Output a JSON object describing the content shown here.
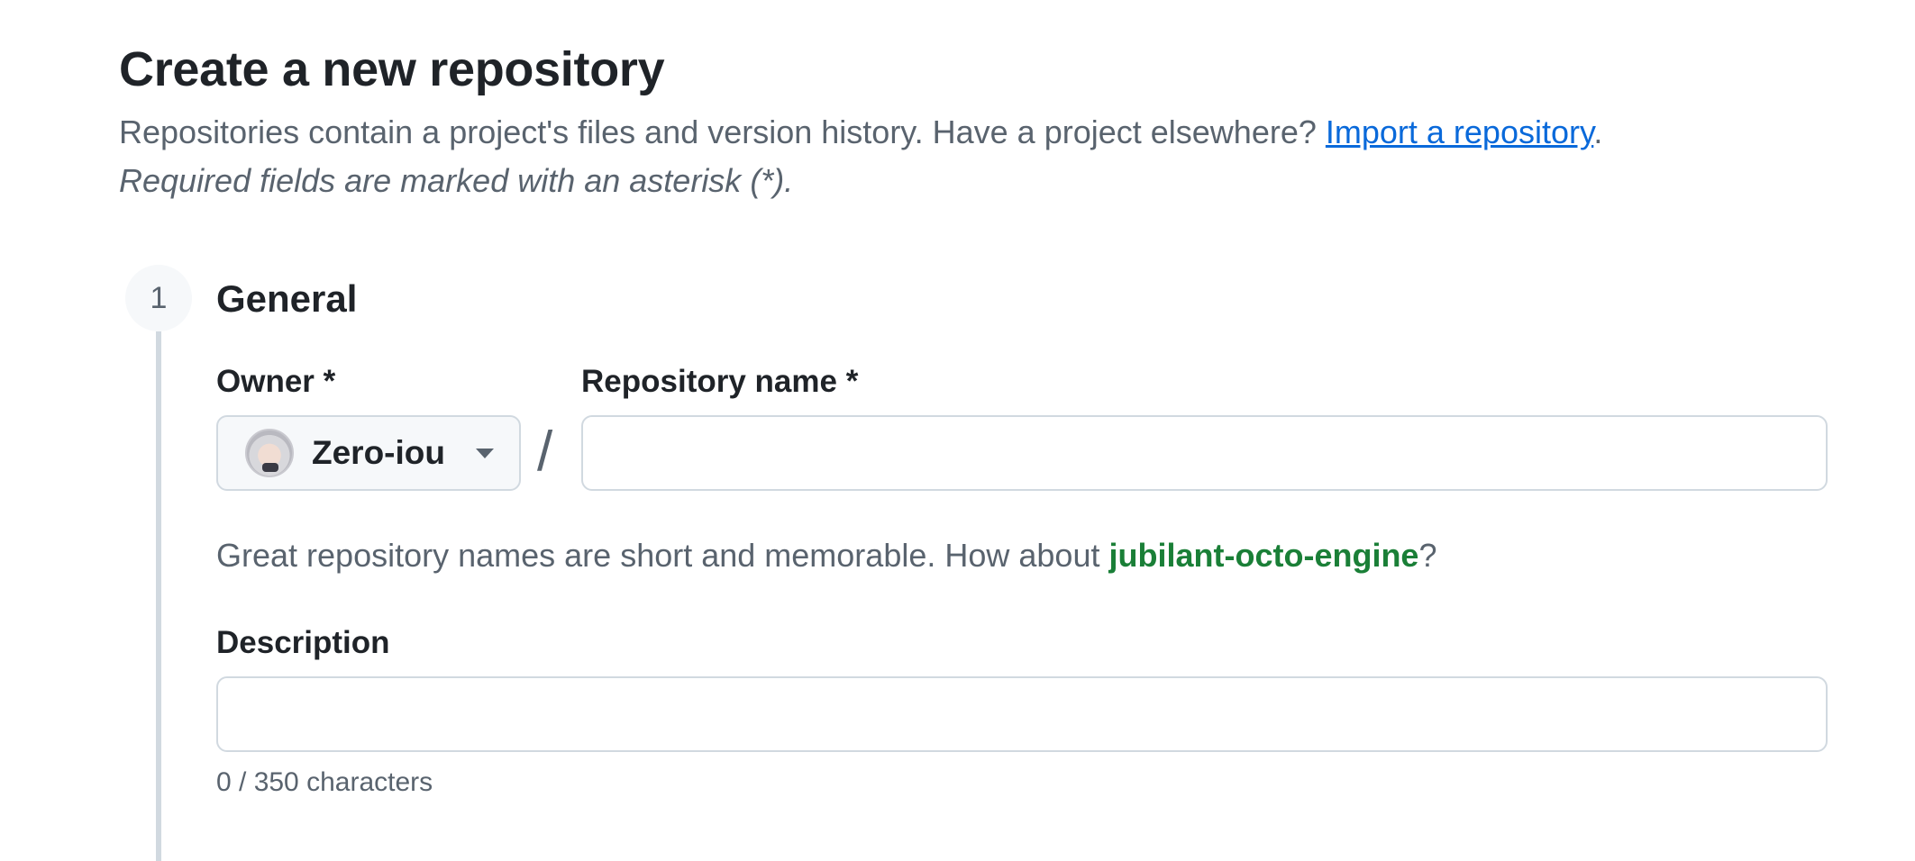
{
  "header": {
    "title": "Create a new repository",
    "subtitle_text": "Repositories contain a project's files and version history. Have a project elsewhere? ",
    "import_link": "Import a repository",
    "subtitle_end": ".",
    "required_note": "Required fields are marked with an asterisk (*)."
  },
  "section": {
    "step_number": "1",
    "title": "General"
  },
  "owner": {
    "label": "Owner *",
    "selected": "Zero-iou",
    "avatar_icon": "user-avatar",
    "dropdown_icon": "caret-down-icon"
  },
  "separator": "/",
  "repo_name": {
    "label": "Repository name *",
    "value": "",
    "placeholder": ""
  },
  "hint": {
    "prefix": "Great repository names are short and memorable. How about ",
    "suggestion": "jubilant-octo-engine",
    "suffix": "?"
  },
  "description": {
    "label": "Description",
    "value": "",
    "placeholder": "",
    "counter": "0 / 350 characters"
  },
  "colors": {
    "link": "#0969da",
    "suggestion": "#1a7f37",
    "muted_text": "#59636e",
    "border": "#d1d9e0"
  }
}
